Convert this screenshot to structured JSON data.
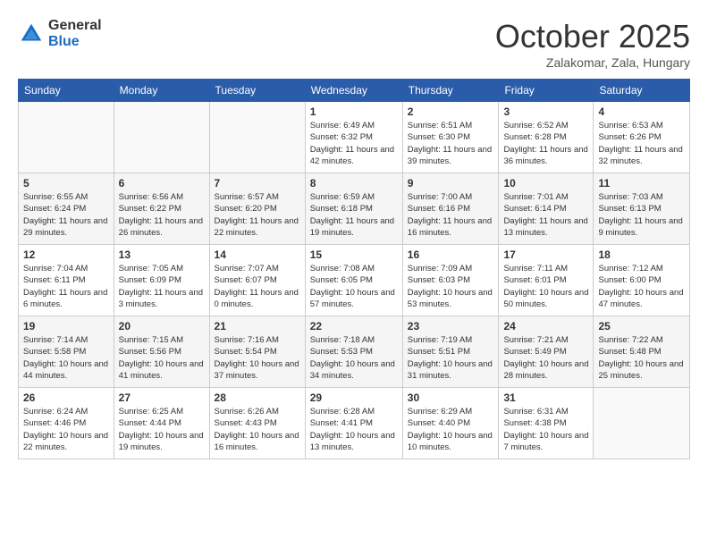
{
  "logo": {
    "general": "General",
    "blue": "Blue"
  },
  "title": "October 2025",
  "subtitle": "Zalakomar, Zala, Hungary",
  "days_header": [
    "Sunday",
    "Monday",
    "Tuesday",
    "Wednesday",
    "Thursday",
    "Friday",
    "Saturday"
  ],
  "weeks": [
    [
      {
        "day": "",
        "info": ""
      },
      {
        "day": "",
        "info": ""
      },
      {
        "day": "",
        "info": ""
      },
      {
        "day": "1",
        "info": "Sunrise: 6:49 AM\nSunset: 6:32 PM\nDaylight: 11 hours and 42 minutes."
      },
      {
        "day": "2",
        "info": "Sunrise: 6:51 AM\nSunset: 6:30 PM\nDaylight: 11 hours and 39 minutes."
      },
      {
        "day": "3",
        "info": "Sunrise: 6:52 AM\nSunset: 6:28 PM\nDaylight: 11 hours and 36 minutes."
      },
      {
        "day": "4",
        "info": "Sunrise: 6:53 AM\nSunset: 6:26 PM\nDaylight: 11 hours and 32 minutes."
      }
    ],
    [
      {
        "day": "5",
        "info": "Sunrise: 6:55 AM\nSunset: 6:24 PM\nDaylight: 11 hours and 29 minutes."
      },
      {
        "day": "6",
        "info": "Sunrise: 6:56 AM\nSunset: 6:22 PM\nDaylight: 11 hours and 26 minutes."
      },
      {
        "day": "7",
        "info": "Sunrise: 6:57 AM\nSunset: 6:20 PM\nDaylight: 11 hours and 22 minutes."
      },
      {
        "day": "8",
        "info": "Sunrise: 6:59 AM\nSunset: 6:18 PM\nDaylight: 11 hours and 19 minutes."
      },
      {
        "day": "9",
        "info": "Sunrise: 7:00 AM\nSunset: 6:16 PM\nDaylight: 11 hours and 16 minutes."
      },
      {
        "day": "10",
        "info": "Sunrise: 7:01 AM\nSunset: 6:14 PM\nDaylight: 11 hours and 13 minutes."
      },
      {
        "day": "11",
        "info": "Sunrise: 7:03 AM\nSunset: 6:13 PM\nDaylight: 11 hours and 9 minutes."
      }
    ],
    [
      {
        "day": "12",
        "info": "Sunrise: 7:04 AM\nSunset: 6:11 PM\nDaylight: 11 hours and 6 minutes."
      },
      {
        "day": "13",
        "info": "Sunrise: 7:05 AM\nSunset: 6:09 PM\nDaylight: 11 hours and 3 minutes."
      },
      {
        "day": "14",
        "info": "Sunrise: 7:07 AM\nSunset: 6:07 PM\nDaylight: 11 hours and 0 minutes."
      },
      {
        "day": "15",
        "info": "Sunrise: 7:08 AM\nSunset: 6:05 PM\nDaylight: 10 hours and 57 minutes."
      },
      {
        "day": "16",
        "info": "Sunrise: 7:09 AM\nSunset: 6:03 PM\nDaylight: 10 hours and 53 minutes."
      },
      {
        "day": "17",
        "info": "Sunrise: 7:11 AM\nSunset: 6:01 PM\nDaylight: 10 hours and 50 minutes."
      },
      {
        "day": "18",
        "info": "Sunrise: 7:12 AM\nSunset: 6:00 PM\nDaylight: 10 hours and 47 minutes."
      }
    ],
    [
      {
        "day": "19",
        "info": "Sunrise: 7:14 AM\nSunset: 5:58 PM\nDaylight: 10 hours and 44 minutes."
      },
      {
        "day": "20",
        "info": "Sunrise: 7:15 AM\nSunset: 5:56 PM\nDaylight: 10 hours and 41 minutes."
      },
      {
        "day": "21",
        "info": "Sunrise: 7:16 AM\nSunset: 5:54 PM\nDaylight: 10 hours and 37 minutes."
      },
      {
        "day": "22",
        "info": "Sunrise: 7:18 AM\nSunset: 5:53 PM\nDaylight: 10 hours and 34 minutes."
      },
      {
        "day": "23",
        "info": "Sunrise: 7:19 AM\nSunset: 5:51 PM\nDaylight: 10 hours and 31 minutes."
      },
      {
        "day": "24",
        "info": "Sunrise: 7:21 AM\nSunset: 5:49 PM\nDaylight: 10 hours and 28 minutes."
      },
      {
        "day": "25",
        "info": "Sunrise: 7:22 AM\nSunset: 5:48 PM\nDaylight: 10 hours and 25 minutes."
      }
    ],
    [
      {
        "day": "26",
        "info": "Sunrise: 6:24 AM\nSunset: 4:46 PM\nDaylight: 10 hours and 22 minutes."
      },
      {
        "day": "27",
        "info": "Sunrise: 6:25 AM\nSunset: 4:44 PM\nDaylight: 10 hours and 19 minutes."
      },
      {
        "day": "28",
        "info": "Sunrise: 6:26 AM\nSunset: 4:43 PM\nDaylight: 10 hours and 16 minutes."
      },
      {
        "day": "29",
        "info": "Sunrise: 6:28 AM\nSunset: 4:41 PM\nDaylight: 10 hours and 13 minutes."
      },
      {
        "day": "30",
        "info": "Sunrise: 6:29 AM\nSunset: 4:40 PM\nDaylight: 10 hours and 10 minutes."
      },
      {
        "day": "31",
        "info": "Sunrise: 6:31 AM\nSunset: 4:38 PM\nDaylight: 10 hours and 7 minutes."
      },
      {
        "day": "",
        "info": ""
      }
    ]
  ]
}
